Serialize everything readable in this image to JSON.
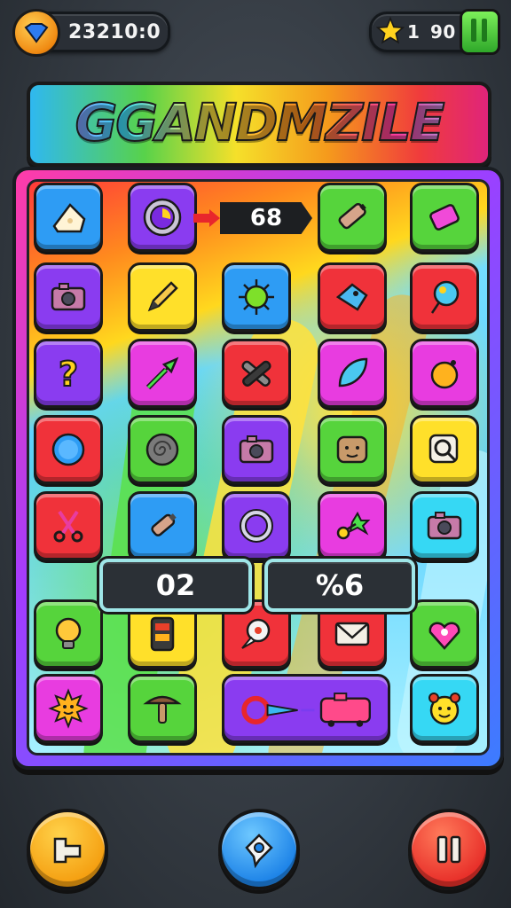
{
  "hud": {
    "coins_value": "23210:0",
    "stars_value": "1",
    "gems_value": "90"
  },
  "title": {
    "text": "GGANDMZILE"
  },
  "board": {
    "combo_banner": "68",
    "score_left": "02",
    "score_right": "%6",
    "tile_icons": [
      "cheese-icon",
      "target-icon",
      "",
      "battery-icon",
      "eraser-icon",
      "camera-icon",
      "pencil-icon",
      "virus-icon",
      "fish-icon",
      "balloon-icon",
      "question-mark-icon",
      "arrow-icon",
      "wrench-icon",
      "leaf-icon",
      "ball-icon",
      "orb-icon",
      "spiral-icon",
      "camera-icon",
      "cookie-face-icon",
      "search-icon",
      "scissors-icon",
      "bottle-icon",
      "ring-icon",
      "clover-icon",
      "camera-icon",
      "",
      "",
      "",
      "",
      "",
      "lightbulb-icon",
      "phone-icon",
      "pin-icon",
      "envelope-icon",
      "gem-heart-icon",
      "sun-face-icon",
      "mushroom-icon",
      "truck-icon",
      "",
      "smiley-icon"
    ]
  },
  "footer": {
    "left_button": "build-icon",
    "center_button": "hint-icon",
    "right_button": "pause-icon"
  },
  "colors": {
    "red": "#f0323a",
    "green": "#56d43c",
    "yellow": "#ffe02a",
    "blue": "#2e9cf4",
    "purple": "#8a3cf0",
    "magenta": "#e83ce0",
    "cyan": "#36d8f4"
  }
}
